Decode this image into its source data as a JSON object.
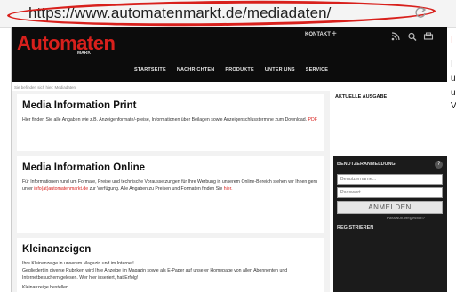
{
  "browser": {
    "url": "https://www.automatenmarkt.de/mediadaten/",
    "reload_icon": "reload-icon"
  },
  "site": {
    "logo": "Automaten",
    "logo_sub": "MARKT",
    "contact_label": "KONTAKT",
    "contact_plus": "+",
    "icons": [
      "rss-icon",
      "search-icon",
      "print-icon"
    ],
    "nav": [
      "STARTSEITE",
      "NACHRICHTEN",
      "PRODUKTE",
      "UNTER UNS",
      "SERVICE"
    ],
    "breadcrumb": "Sie befinden sich hier: Mediadaten",
    "accent_color": "#d8201c"
  },
  "main": {
    "print": {
      "title": "Media Information Print",
      "text": "Hier finden Sie alle Angaben wie z.B. Anzeigenformate/-preise, Informationen über Beilagen sowie Anzeigenschlusstermine zum Download.",
      "link": "PDF"
    },
    "online": {
      "title": "Media Information Online",
      "text1": "Für Informationen rund um Formate, Preise und technische Voraussetzungen für Ihre Werbung in unserem Online-Bereich stehen wir Ihnen gern unter",
      "email": "info(at)automatenmarkt.de",
      "text2": "zur Verfügung. Alle Angaben zu Preisen und Formaten finden Sie",
      "link": "hier."
    },
    "classifieds": {
      "title": "Kleinanzeigen",
      "line1": "Ihre Kleinanzeige in unserem Magazin und im Internet!",
      "line2": "Gegliedert in diverse Rubriken wird Ihre Anzeige im Magazin sowie als E-Paper auf unserer Homepage von allen Abonnenten und Internetbesuchern gelesen. Wer hier inseriert, hat Erfolg!",
      "order": "Kleinanzeige bestellen"
    }
  },
  "sidebar": {
    "current_issue": "AKTUELLE AUSGABE",
    "login_heading": "BENUTZERANMELDUNG",
    "help": "?",
    "username_placeholder": "Benutzername...",
    "password_placeholder": "Passwort...",
    "login_button": "ANMELDEN",
    "forgot": "Passwort vergessen?",
    "register": "REGISTRIEREN"
  },
  "cut_off_right": {
    "line1": "I",
    "line2": "I",
    "line3": "u",
    "line4": "u",
    "line5": "V"
  }
}
